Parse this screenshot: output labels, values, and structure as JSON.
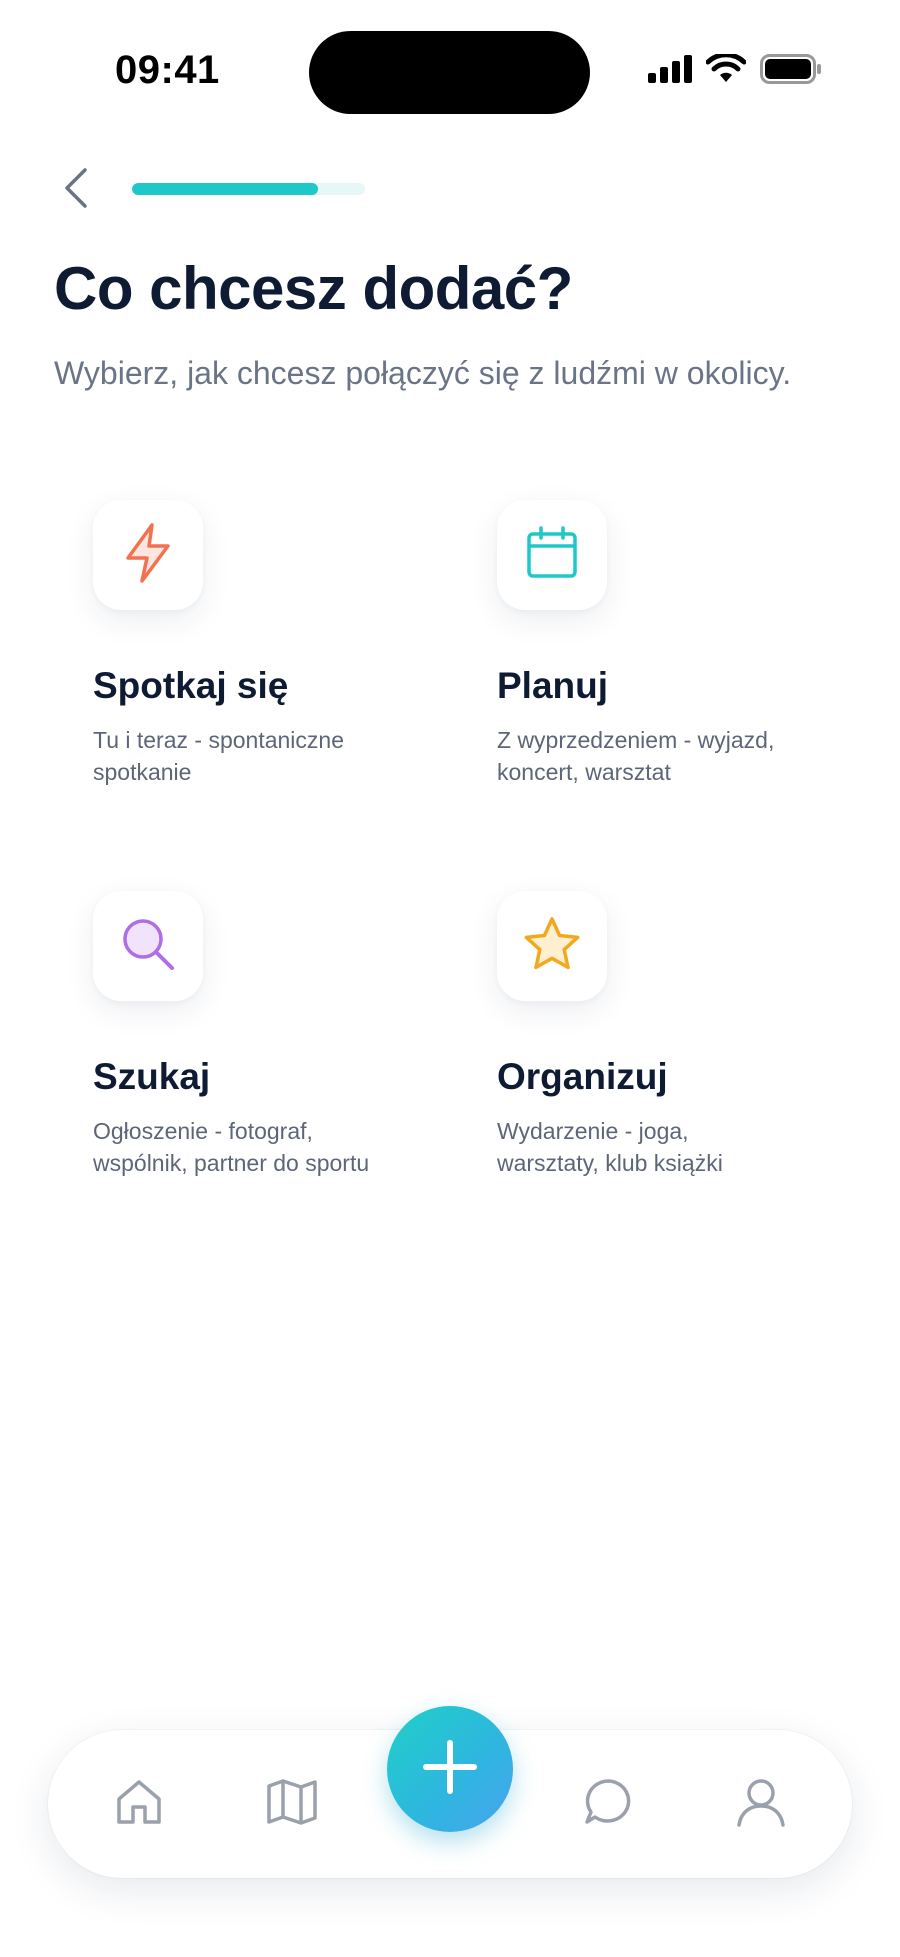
{
  "status_bar": {
    "time": "09:41",
    "icons": [
      "cellular-signal-icon",
      "wifi-icon",
      "battery-icon"
    ]
  },
  "nav": {
    "back_icon": "chevron-left-icon",
    "progress": 0.8
  },
  "header": {
    "title": "Co chcesz dodać?",
    "subtitle": "Wybierz, jak chcesz połączyć się z ludźmi w okolicy."
  },
  "options": [
    {
      "icon": "lightning-icon",
      "icon_color": "#f2714f",
      "title": "Spotkaj się",
      "desc_line1": "Tu i teraz - spontaniczne",
      "desc_line2": "spotkanie"
    },
    {
      "icon": "calendar-icon",
      "icon_color": "#1ec8c8",
      "title": "Planuj",
      "desc_line1": "Z wyprzedzeniem - wyjazd,",
      "desc_line2": "koncert, warsztat"
    },
    {
      "icon": "search-icon",
      "icon_color": "#b06ee6",
      "title": "Szukaj",
      "desc_line1": "Ogłoszenie - fotograf,",
      "desc_line2": "wspólnik, partner do sportu"
    },
    {
      "icon": "star-icon",
      "icon_color": "#f2a81c",
      "title": "Organizuj",
      "desc_line1": "Wydarzenie - joga,",
      "desc_line2": "warsztaty, klub książki"
    }
  ],
  "tabbar": {
    "items": [
      "home-icon",
      "map-icon",
      "plus-icon",
      "chat-icon",
      "profile-icon"
    ],
    "fab_gradient": [
      "#1fd0c8",
      "#4aa3ef"
    ],
    "inactive_color": "#9aa1ac"
  }
}
